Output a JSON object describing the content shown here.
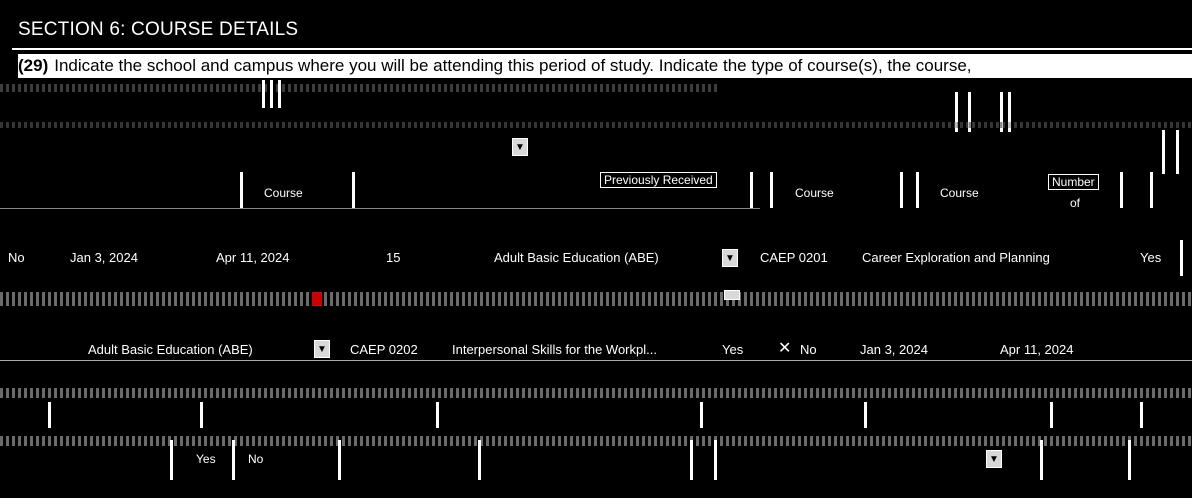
{
  "section": {
    "title": "SECTION 6: COURSE DETAILS"
  },
  "question": {
    "number": "(29)",
    "text": "Indicate the school and campus where you will be attending this period of study. Indicate the type of course(s), the course,"
  },
  "columns": {
    "previously_received": "Previously Received",
    "course_a": "Course",
    "course_b": "Course",
    "course_c": "Course",
    "number": "Number",
    "of": "of"
  },
  "row1": {
    "no": "No",
    "start_date": "Jan 3, 2024",
    "end_date": "Apr 11, 2024",
    "hours": "15",
    "course_type": "Adult Basic Education (ABE)",
    "course_code": "CAEP 0201",
    "course_name": "Career Exploration and Planning",
    "answer": "Yes"
  },
  "row3": {
    "course_type": "Adult Basic Education (ABE)",
    "course_code": "CAEP 0202",
    "course_name": "Interpersonal Skills for the Workpl...",
    "yes": "Yes",
    "no": "No",
    "start_date": "Jan 3, 2024",
    "end_date": "Apr 11, 2024"
  },
  "footer": {
    "yes": "Yes",
    "no": "No"
  },
  "colors": {
    "background": "#000000",
    "text": "#ffffff",
    "glitch": "#777777"
  },
  "icons": [
    "chevron-down-icon",
    "close-icon"
  ]
}
